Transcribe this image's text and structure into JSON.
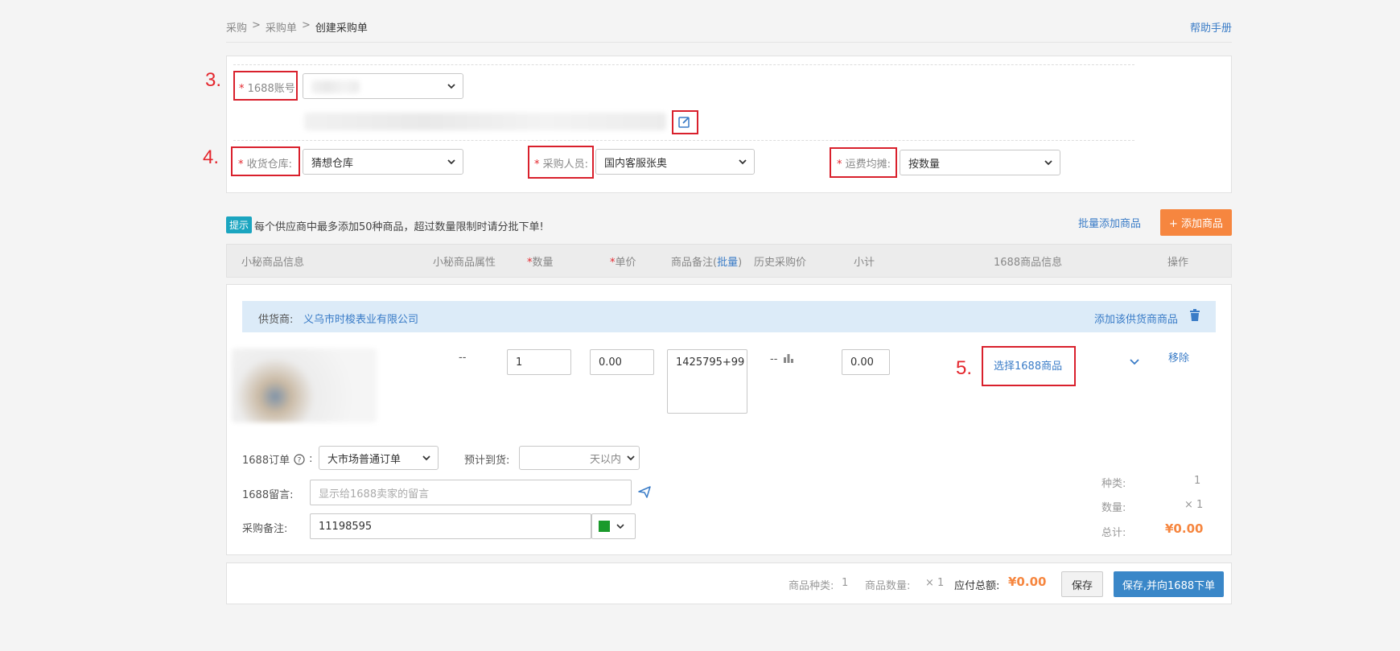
{
  "breadcrumb": [
    "采购",
    "采购单",
    "创建采购单"
  ],
  "breadcrumb_sep": ">",
  "help_link": "帮助手册",
  "annotations": [
    "3.",
    "4.",
    "5."
  ],
  "form": {
    "account_label": "1688账号:",
    "warehouse_label": "收货仓库:",
    "warehouse_value": "猜想仓库",
    "buyer_label": "采购人员:",
    "buyer_value": "国内客服张奥",
    "freight_label": "运费均摊:",
    "freight_value": "按数量",
    "required_mark": "*"
  },
  "tip": {
    "badge": "提示",
    "text": "每个供应商中最多添加50种商品，超过数量限制时请分批下单!",
    "batch_add": "批量添加商品",
    "add_goods": "+ 添加商品"
  },
  "table_headers": {
    "info": "小秘商品信息",
    "attr": "小秘商品属性",
    "qty": "数量",
    "price": "单价",
    "note_prefix": "商品备注(",
    "note_link": "批量",
    "note_suffix": ")",
    "history": "历史采购价",
    "subtotal": "小计",
    "info1688": "1688商品信息",
    "ops": "操作"
  },
  "supplier": {
    "label": "供货商:",
    "name": "义乌市时梭表业有限公司",
    "add_link": "添加该供货商商品"
  },
  "row": {
    "attr": "--",
    "qty": "1",
    "price": "0.00",
    "note": "1425795+99",
    "history": "--",
    "subtotal": "0.00",
    "select_1688": "选择1688商品",
    "remove": "移除"
  },
  "order": {
    "order_label": "1688订单",
    "colon": ":",
    "order_type": "大市场普通订单",
    "arrival_label": "预计到货:",
    "arrival_unit": "天以内",
    "message_label": "1688留言:",
    "message_placeholder": "显示给1688卖家的留言",
    "remark_label": "采购备注:",
    "remark_value": "11198595"
  },
  "summary": {
    "kind_label": "种类:",
    "kind_value": "1",
    "qty_label": "数量:",
    "qty_value": "× 1",
    "total_label": "总计:",
    "total_value": "¥0.00"
  },
  "footer": {
    "kind_label": "商品种类:",
    "kind_value": "1",
    "qty_label": "商品数量:",
    "qty_value": "× 1",
    "total_label": "应付总额:",
    "total_value": "¥0.00",
    "save": "保存",
    "save_order": "保存,并向1688下单"
  },
  "colors": {
    "accent": "#3a7cc7",
    "orange": "#f6863f",
    "annotation": "#e4262d",
    "tip_badge": "#1ba5c0",
    "remark_color": "#1a9a2b"
  }
}
